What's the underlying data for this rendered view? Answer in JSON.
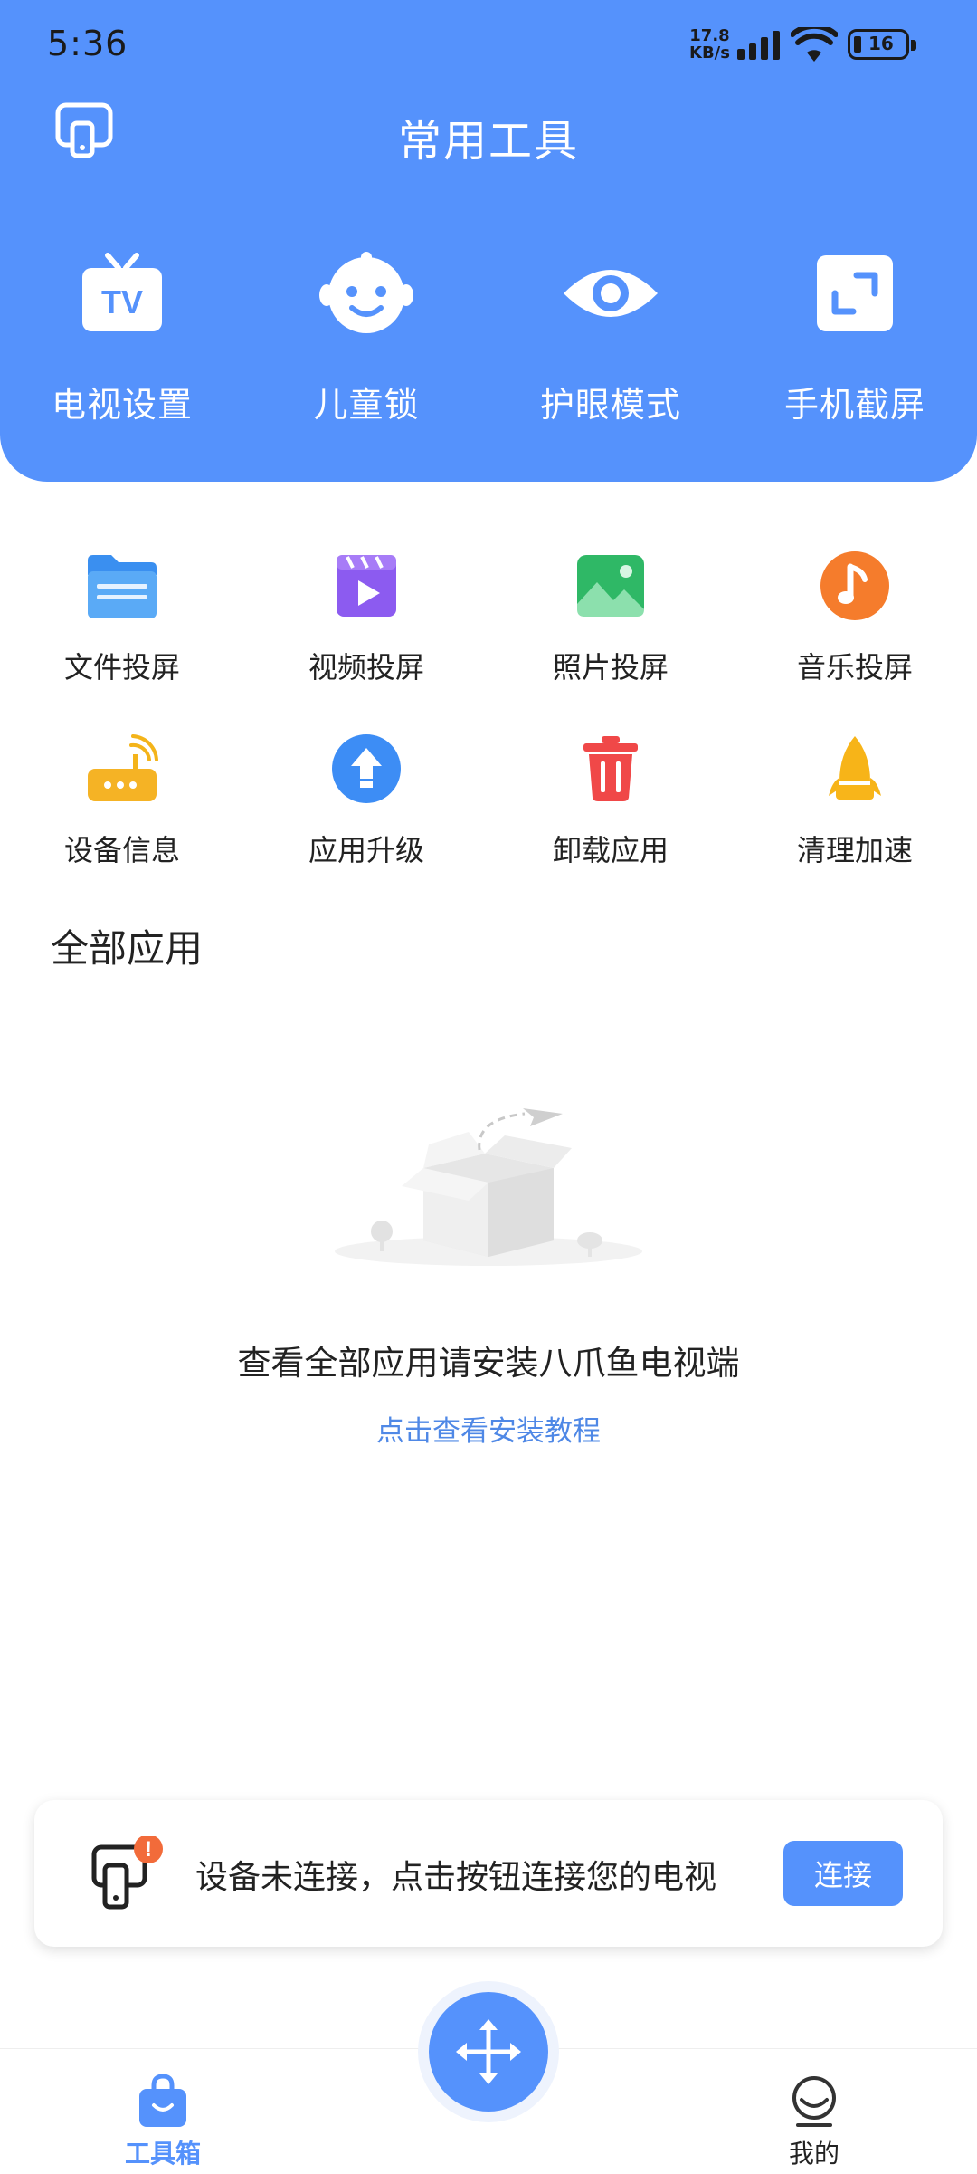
{
  "status_bar": {
    "time": "5:36",
    "net_speed_value": "17.8",
    "net_speed_unit": "KB/s",
    "battery_level": "16"
  },
  "header": {
    "title": "常用工具",
    "tools": [
      {
        "label": "电视设置",
        "icon": "tv-icon"
      },
      {
        "label": "儿童锁",
        "icon": "child-face-icon"
      },
      {
        "label": "护眼模式",
        "icon": "eye-icon"
      },
      {
        "label": "手机截屏",
        "icon": "screenshot-icon"
      }
    ]
  },
  "grid": [
    {
      "label": "文件投屏",
      "icon": "folder-icon"
    },
    {
      "label": "视频投屏",
      "icon": "video-icon"
    },
    {
      "label": "照片投屏",
      "icon": "photo-icon"
    },
    {
      "label": "音乐投屏",
      "icon": "music-icon"
    },
    {
      "label": "设备信息",
      "icon": "router-icon"
    },
    {
      "label": "应用升级",
      "icon": "upgrade-icon"
    },
    {
      "label": "卸载应用",
      "icon": "trash-icon"
    },
    {
      "label": "清理加速",
      "icon": "rocket-icon"
    }
  ],
  "all_apps": {
    "title": "全部应用",
    "empty_message": "查看全部应用请安装八爪鱼电视端",
    "install_link": "点击查看安装教程"
  },
  "connection_banner": {
    "message": "设备未连接，点击按钮连接您的电视",
    "button_label": "连接",
    "alert_badge": "!"
  },
  "bottom_nav": {
    "items": [
      {
        "label": "工具箱",
        "active": true
      },
      {
        "label": "我的",
        "active": false
      }
    ]
  },
  "colors": {
    "primary": "#5592fc",
    "link": "#4f88e6",
    "alert": "#f26b3a"
  }
}
